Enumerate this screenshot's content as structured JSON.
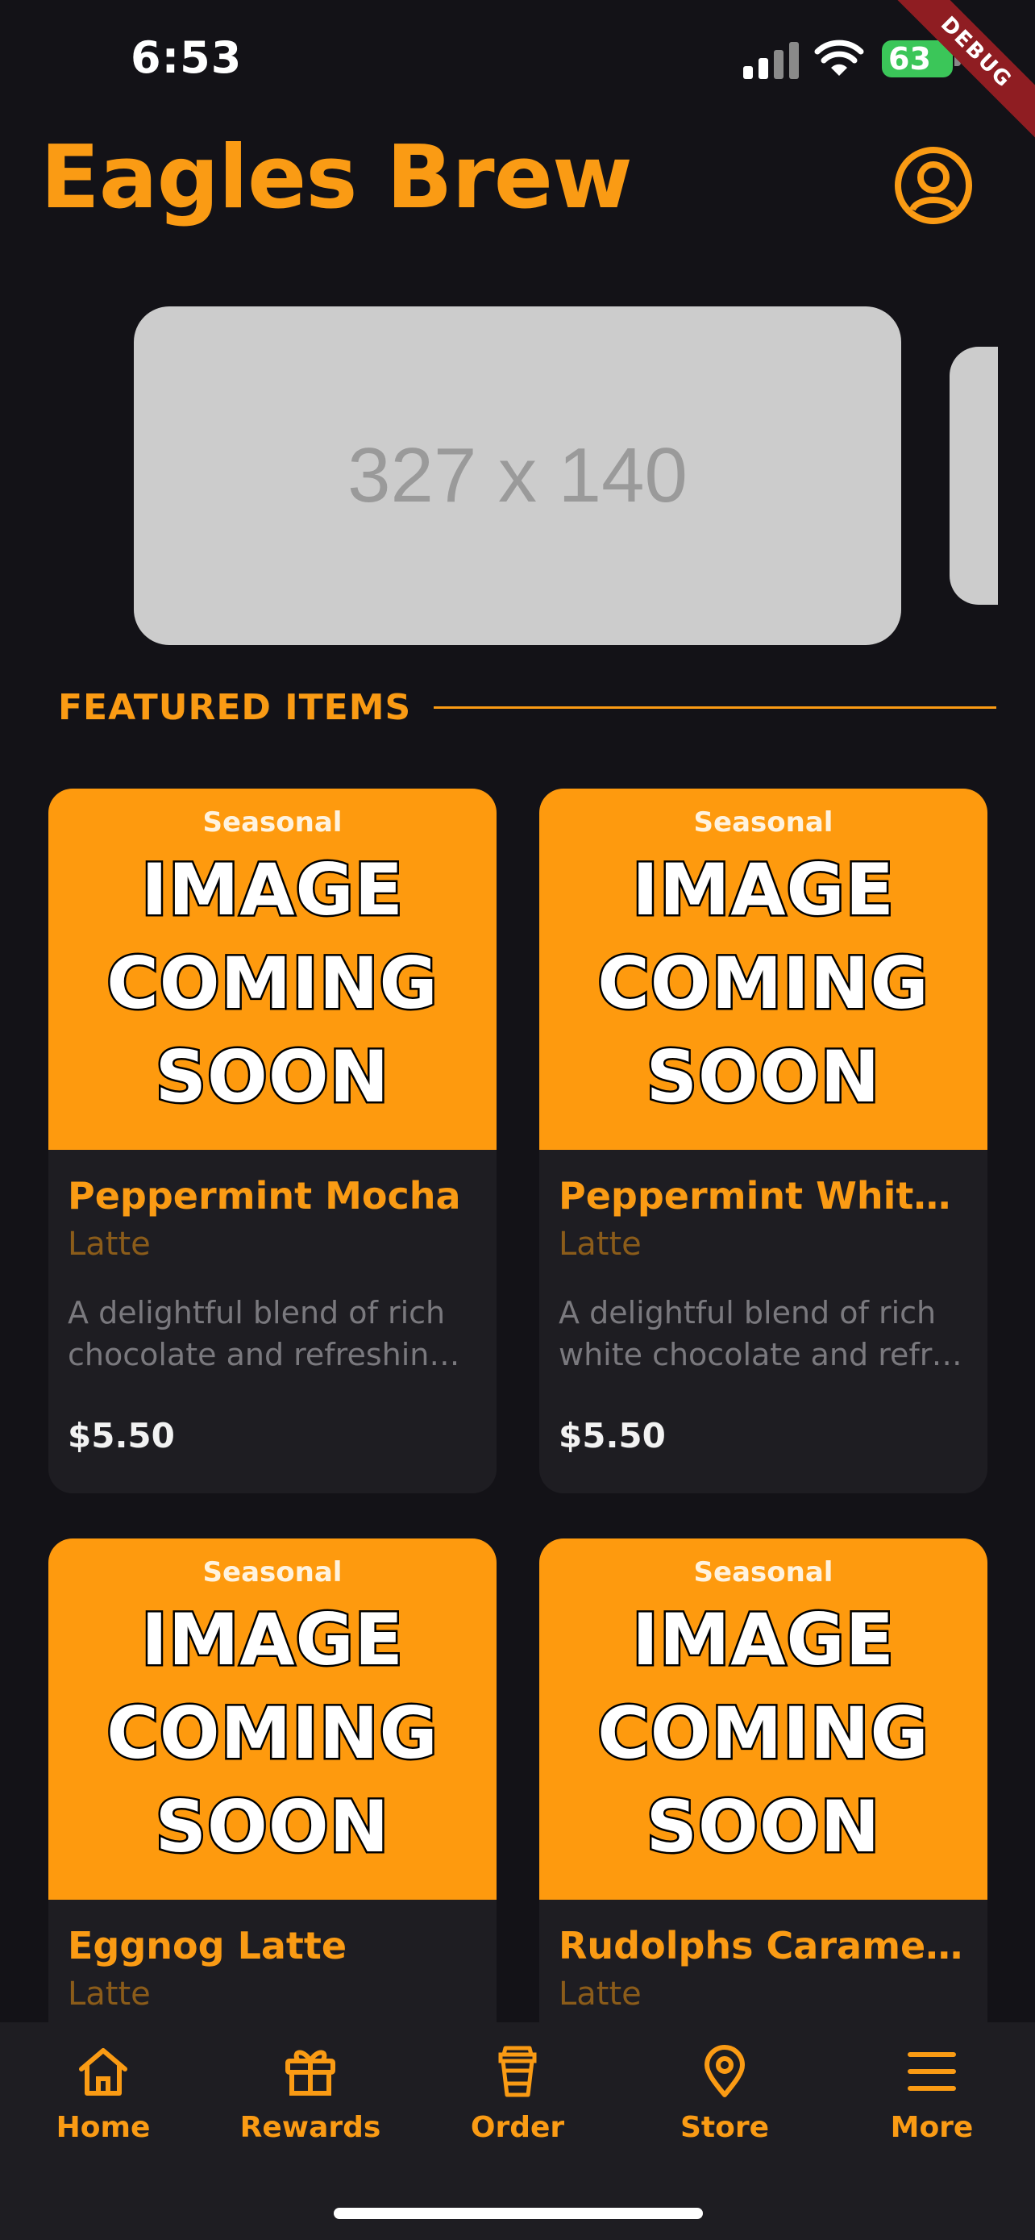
{
  "status_bar": {
    "time": "6:53",
    "battery": "63"
  },
  "debug_label": "DEBUG",
  "header": {
    "title": "Eagles Brew"
  },
  "banner": {
    "placeholder_text": "327 x 140"
  },
  "section": {
    "title": "FEATURED ITEMS"
  },
  "placeholder_image": {
    "tag": "Seasonal",
    "lines": [
      "IMAGE",
      "COMING",
      "SOON"
    ]
  },
  "items": [
    {
      "name": "Peppermint Mocha",
      "category": "Latte",
      "desc_lines": [
        "A delightful blend of rich",
        "chocolate and refreshing …"
      ],
      "price": "$5.50"
    },
    {
      "name": "Peppermint White …",
      "category": "Latte",
      "desc_lines": [
        "A delightful blend of rich",
        "white chocolate and refre…"
      ],
      "price": "$5.50"
    },
    {
      "name": "Eggnog Latte",
      "category": "Latte"
    },
    {
      "name": "Rudolphs Caramel…",
      "category": "Latte"
    }
  ],
  "tabs": [
    {
      "label": "Home",
      "icon": "home-icon"
    },
    {
      "label": "Rewards",
      "icon": "gift-icon"
    },
    {
      "label": "Order",
      "icon": "cup-icon"
    },
    {
      "label": "Store",
      "icon": "location-pin-icon"
    },
    {
      "label": "More",
      "icon": "menu-icon"
    }
  ],
  "colors": {
    "accent": "#fa9b14",
    "background": "#131217",
    "card": "#1e1d22",
    "image_placeholder": "#fe9a0e"
  }
}
